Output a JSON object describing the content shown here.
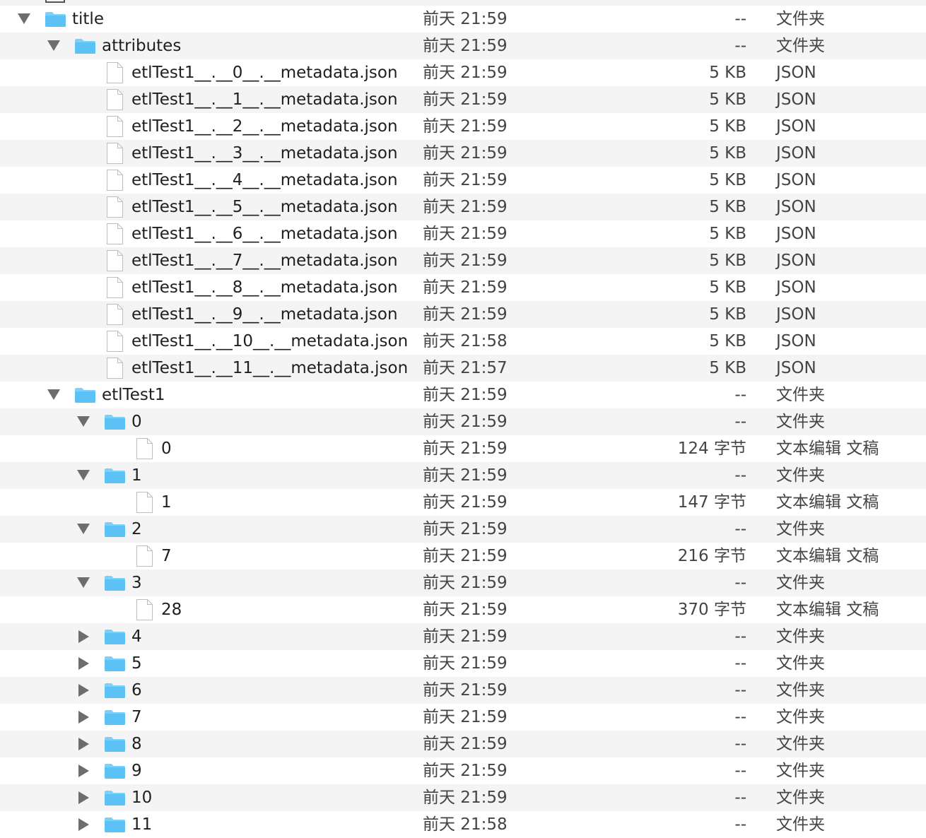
{
  "rows": [
    {
      "name": "title",
      "date": "前天 21:59",
      "size": "--",
      "kind": "文件夹",
      "type": "folder",
      "depth": 0,
      "expanded": true
    },
    {
      "name": "attributes",
      "date": "前天 21:59",
      "size": "--",
      "kind": "文件夹",
      "type": "folder",
      "depth": 1,
      "expanded": true
    },
    {
      "name": "etlTest1__.__0__.__metadata.json",
      "date": "前天 21:59",
      "size": "5 KB",
      "kind": "JSON",
      "type": "file",
      "depth": 2
    },
    {
      "name": "etlTest1__.__1__.__metadata.json",
      "date": "前天 21:59",
      "size": "5 KB",
      "kind": "JSON",
      "type": "file",
      "depth": 2
    },
    {
      "name": "etlTest1__.__2__.__metadata.json",
      "date": "前天 21:59",
      "size": "5 KB",
      "kind": "JSON",
      "type": "file",
      "depth": 2
    },
    {
      "name": "etlTest1__.__3__.__metadata.json",
      "date": "前天 21:59",
      "size": "5 KB",
      "kind": "JSON",
      "type": "file",
      "depth": 2
    },
    {
      "name": "etlTest1__.__4__.__metadata.json",
      "date": "前天 21:59",
      "size": "5 KB",
      "kind": "JSON",
      "type": "file",
      "depth": 2
    },
    {
      "name": "etlTest1__.__5__.__metadata.json",
      "date": "前天 21:59",
      "size": "5 KB",
      "kind": "JSON",
      "type": "file",
      "depth": 2
    },
    {
      "name": "etlTest1__.__6__.__metadata.json",
      "date": "前天 21:59",
      "size": "5 KB",
      "kind": "JSON",
      "type": "file",
      "depth": 2
    },
    {
      "name": "etlTest1__.__7__.__metadata.json",
      "date": "前天 21:59",
      "size": "5 KB",
      "kind": "JSON",
      "type": "file",
      "depth": 2
    },
    {
      "name": "etlTest1__.__8__.__metadata.json",
      "date": "前天 21:59",
      "size": "5 KB",
      "kind": "JSON",
      "type": "file",
      "depth": 2
    },
    {
      "name": "etlTest1__.__9__.__metadata.json",
      "date": "前天 21:59",
      "size": "5 KB",
      "kind": "JSON",
      "type": "file",
      "depth": 2
    },
    {
      "name": "etlTest1__.__10__.__metadata.json",
      "date": "前天 21:58",
      "size": "5 KB",
      "kind": "JSON",
      "type": "file",
      "depth": 2
    },
    {
      "name": "etlTest1__.__11__.__metadata.json",
      "date": "前天 21:57",
      "size": "5 KB",
      "kind": "JSON",
      "type": "file",
      "depth": 2
    },
    {
      "name": "etlTest1",
      "date": "前天 21:59",
      "size": "--",
      "kind": "文件夹",
      "type": "folder",
      "depth": 1,
      "expanded": true
    },
    {
      "name": "0",
      "date": "前天 21:59",
      "size": "--",
      "kind": "文件夹",
      "type": "folder",
      "depth": 2,
      "expanded": true
    },
    {
      "name": "0",
      "date": "前天 21:59",
      "size": "124 字节",
      "kind": "文本编辑 文稿",
      "type": "file",
      "depth": 3
    },
    {
      "name": "1",
      "date": "前天 21:59",
      "size": "--",
      "kind": "文件夹",
      "type": "folder",
      "depth": 2,
      "expanded": true
    },
    {
      "name": "1",
      "date": "前天 21:59",
      "size": "147 字节",
      "kind": "文本编辑 文稿",
      "type": "file",
      "depth": 3
    },
    {
      "name": "2",
      "date": "前天 21:59",
      "size": "--",
      "kind": "文件夹",
      "type": "folder",
      "depth": 2,
      "expanded": true
    },
    {
      "name": "7",
      "date": "前天 21:59",
      "size": "216 字节",
      "kind": "文本编辑 文稿",
      "type": "file",
      "depth": 3
    },
    {
      "name": "3",
      "date": "前天 21:59",
      "size": "--",
      "kind": "文件夹",
      "type": "folder",
      "depth": 2,
      "expanded": true
    },
    {
      "name": "28",
      "date": "前天 21:59",
      "size": "370 字节",
      "kind": "文本编辑 文稿",
      "type": "file",
      "depth": 3
    },
    {
      "name": "4",
      "date": "前天 21:59",
      "size": "--",
      "kind": "文件夹",
      "type": "folder",
      "depth": 2,
      "expanded": false
    },
    {
      "name": "5",
      "date": "前天 21:59",
      "size": "--",
      "kind": "文件夹",
      "type": "folder",
      "depth": 2,
      "expanded": false
    },
    {
      "name": "6",
      "date": "前天 21:59",
      "size": "--",
      "kind": "文件夹",
      "type": "folder",
      "depth": 2,
      "expanded": false
    },
    {
      "name": "7",
      "date": "前天 21:59",
      "size": "--",
      "kind": "文件夹",
      "type": "folder",
      "depth": 2,
      "expanded": false
    },
    {
      "name": "8",
      "date": "前天 21:59",
      "size": "--",
      "kind": "文件夹",
      "type": "folder",
      "depth": 2,
      "expanded": false
    },
    {
      "name": "9",
      "date": "前天 21:59",
      "size": "--",
      "kind": "文件夹",
      "type": "folder",
      "depth": 2,
      "expanded": false
    },
    {
      "name": "10",
      "date": "前天 21:59",
      "size": "--",
      "kind": "文件夹",
      "type": "folder",
      "depth": 2,
      "expanded": false
    },
    {
      "name": "11",
      "date": "前天 21:58",
      "size": "--",
      "kind": "文件夹",
      "type": "folder",
      "depth": 2,
      "expanded": false
    }
  ],
  "colors": {
    "folder_body": "#5cc2f5",
    "folder_tab": "#7fd0f8",
    "alt_row": "#f4f4f4",
    "disclosure": "#6d6d6d"
  }
}
